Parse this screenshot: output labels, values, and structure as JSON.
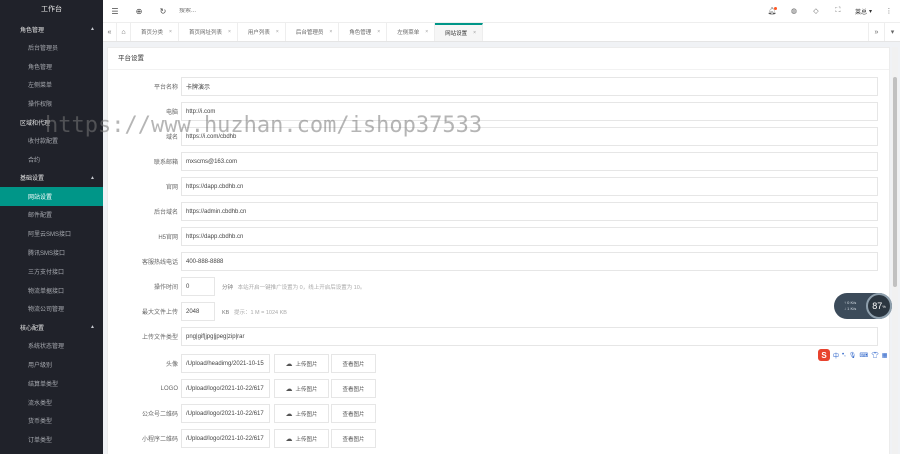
{
  "sidebar": {
    "logo": "工作台",
    "groups": [
      {
        "label": "角色管理",
        "caret": "▲",
        "items": [
          "后台管理员",
          "角色管理",
          "左侧菜单",
          "操作权限"
        ]
      },
      {
        "label": "区域和代理",
        "items": [
          "收付款配置",
          "合约"
        ]
      },
      {
        "label": "基础设置",
        "caret": "▲",
        "items": [
          "网站设置",
          "邮件配置",
          "阿里云SMS接口",
          "腾讯SMS接口",
          "三方支付接口",
          "物流单据接口",
          "物流公司管理"
        ]
      },
      {
        "label": "核心配置",
        "caret": "▲",
        "items": [
          "系统状态管理",
          "用户级别",
          "结算单类型",
          "流水类型",
          "货币类型",
          "订单类型"
        ]
      }
    ],
    "active_item": "网站设置"
  },
  "header": {
    "search_placeholder": "搜索...",
    "user_name": "莱总",
    "icons": [
      "menu-toggle-icon",
      "globe-icon",
      "refresh-icon",
      "bell-icon",
      "theme-icon",
      "tag-icon",
      "fullscreen-icon",
      "more-icon"
    ]
  },
  "tabs": {
    "items": [
      {
        "label": "首页分类",
        "active": false
      },
      {
        "label": "首页网址列表",
        "active": false
      },
      {
        "label": "用户列表",
        "active": false
      },
      {
        "label": "后台管理员",
        "active": false
      },
      {
        "label": "角色管理",
        "active": false
      },
      {
        "label": "左侧菜单",
        "active": false
      },
      {
        "label": "网站设置",
        "active": true
      }
    ],
    "close_glyph": "×"
  },
  "card": {
    "title": "平台设置",
    "fields": [
      {
        "label": "平台名称",
        "value": "卡牌演示"
      },
      {
        "label": "电脑",
        "value": "http://i.com"
      },
      {
        "label": "域名",
        "value": "https://i.com/cbdhb"
      },
      {
        "label": "联系邮箱",
        "value": "mxscms@163.com"
      },
      {
        "label": "官网",
        "value": "https://dapp.cbdhb.cn"
      },
      {
        "label": "后台域名",
        "value": "https://admin.cbdhb.cn"
      },
      {
        "label": "H5官网",
        "value": "https://dapp.cbdhb.cn"
      },
      {
        "label": "客服热线电话",
        "value": "400-888-8888"
      },
      {
        "label": "操作时间",
        "value": "0",
        "unit": "分钟",
        "hint": "本站开启一键推广设置为 0，线上开启后设置为 10。"
      },
      {
        "label": "最大文件上传",
        "value": "2048",
        "unit": "KB",
        "hint": "提示：1 M = 1024 KB"
      },
      {
        "label": "上传文件类型",
        "value": "png|gif|jpg|jpeg|zip|rar"
      }
    ],
    "uploads": [
      {
        "label": "头像",
        "value": "/Upload/headimg/2021-10-15",
        "upload_label": "上传图片",
        "view_label": "查看图片"
      },
      {
        "label": "LOGO",
        "value": "/Upload/logo/2021-10-22/617",
        "upload_label": "上传图片",
        "view_label": "查看图片"
      },
      {
        "label": "公众号二维码",
        "value": "/Upload/logo/2021-10-22/617",
        "upload_label": "上传图片",
        "view_label": "查看图片"
      },
      {
        "label": "小程序二维码",
        "value": "/Upload/logo/2021-10-22/617",
        "upload_label": "上传图片",
        "view_label": "查看图片"
      }
    ]
  },
  "watermark": "https://www.huzhan.com/ishop37533",
  "speed_widget": {
    "up": "0 K/s",
    "down": "1 K/s",
    "value": "87",
    "unit": "%"
  },
  "ime": {
    "logo": "S",
    "mode": "中"
  },
  "colors": {
    "accent": "#009688",
    "sidebar_bg": "#20222a",
    "notify_dot": "#ff5722"
  }
}
